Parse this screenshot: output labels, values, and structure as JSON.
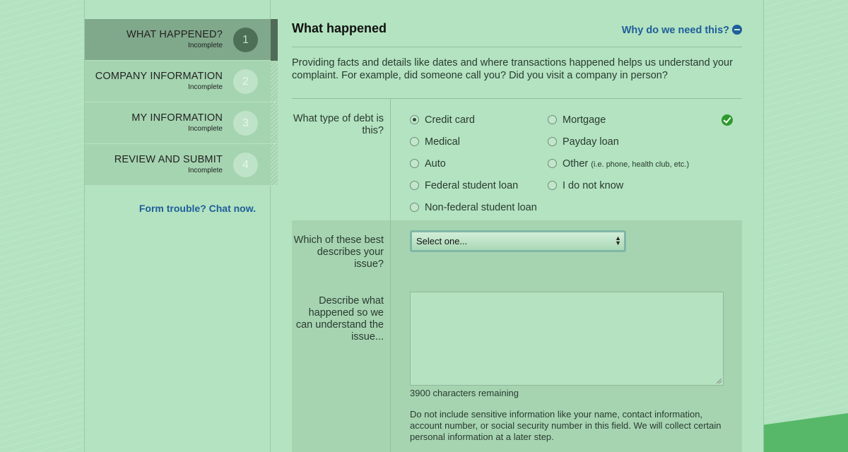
{
  "sidebar": {
    "steps": [
      {
        "title": "WHAT HAPPENED?",
        "status": "Incomplete",
        "number": "1",
        "active": true
      },
      {
        "title": "COMPANY INFORMATION",
        "status": "Incomplete",
        "number": "2",
        "active": false
      },
      {
        "title": "MY INFORMATION",
        "status": "Incomplete",
        "number": "3",
        "active": false
      },
      {
        "title": "REVIEW AND SUBMIT",
        "status": "Incomplete",
        "number": "4",
        "active": false
      }
    ],
    "chat_link": "Form trouble? Chat now."
  },
  "main": {
    "title": "What happened",
    "why_link": "Why do we need this?",
    "intro": "Providing facts and details like dates and where transactions happened helps us understand your complaint. For example, did someone call you? Did you visit a company in person?",
    "debt_type": {
      "label": "What type of debt is this?",
      "options": [
        {
          "label": "Credit card",
          "checked": true
        },
        {
          "label": "Medical",
          "checked": false
        },
        {
          "label": "Auto",
          "checked": false
        },
        {
          "label": "Federal student loan",
          "checked": false
        },
        {
          "label": "Non-federal student loan",
          "checked": false
        },
        {
          "label": "Mortgage",
          "checked": false
        },
        {
          "label": "Payday loan",
          "checked": false
        },
        {
          "label": "Other",
          "hint": "(i.e. phone, health club, etc.)",
          "checked": false
        },
        {
          "label": "I do not know",
          "checked": false
        }
      ]
    },
    "issue": {
      "label": "Which of these best describes your issue?",
      "selected": "Select one..."
    },
    "describe": {
      "label": "Describe what happened so we can understand the issue...",
      "value": "",
      "chars_remaining": "3900 characters remaining",
      "notice": "Do not include sensitive information like your name, contact information, account number, or social security number in this field. We will collect certain personal information at a later step."
    }
  },
  "colors": {
    "background": "#b3e3c0",
    "link": "#1f5d9c",
    "active_step": "#80a88b",
    "success": "#2e9a2e"
  }
}
